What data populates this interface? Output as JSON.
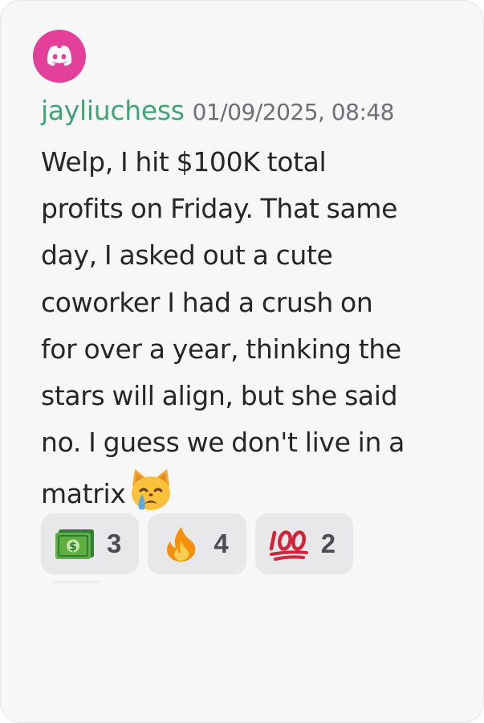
{
  "avatar": {
    "icon": "discord-logo-icon",
    "background": "#e3409a"
  },
  "message": {
    "username": "jayliuchess",
    "username_color": "#3fa477",
    "timestamp": "01/09/2025, 08:48",
    "lines": [
      "Welp, I hit $100K total",
      "profits on Friday. That same",
      "day, I asked out a cute",
      "coworker I had a crush on",
      "for over a year, thinking the",
      "stars will align, but she said",
      "no. I guess we don't live in a",
      "matrix"
    ],
    "trailing_emoji": "crying-cat-face-emoji"
  },
  "reactions": [
    {
      "emoji": "dollar-banknote-icon",
      "count": "3"
    },
    {
      "emoji": "fire-icon",
      "count": "4"
    },
    {
      "emoji": "hundred-points-icon",
      "count": "2"
    }
  ]
}
